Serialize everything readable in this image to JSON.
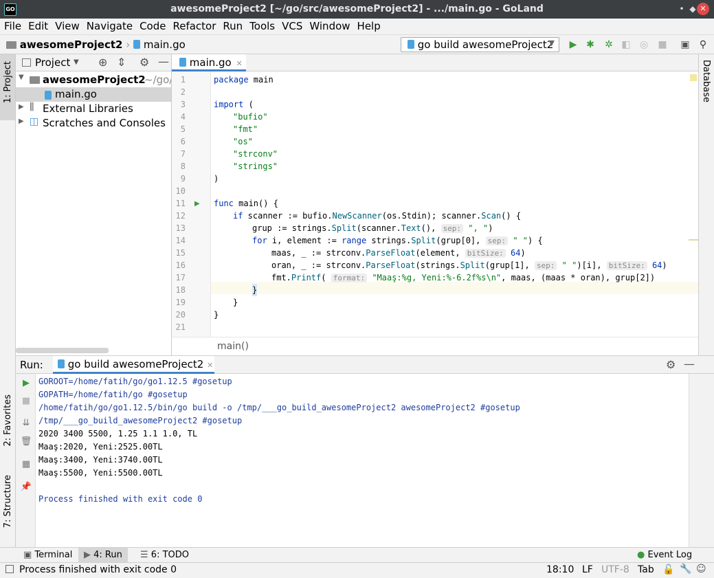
{
  "window": {
    "title": "awesomeProject2 [~/go/src/awesomeProject2] - .../main.go - GoLand",
    "app_icon": "GO",
    "minimize": "•",
    "maximize": "◆",
    "close": "✕"
  },
  "menu": [
    "File",
    "Edit",
    "View",
    "Navigate",
    "Code",
    "Refactor",
    "Run",
    "Tools",
    "VCS",
    "Window",
    "Help"
  ],
  "navbar": {
    "project": "awesomeProject2",
    "file": "main.go",
    "run_config": "go build awesomeProject2"
  },
  "left_strip": {
    "project_tab": "1: Project",
    "favorites_tab": "2: Favorites",
    "structure_tab": "7: Structure"
  },
  "right_strip": {
    "database_tab": "Database"
  },
  "project_panel": {
    "title": "Project",
    "tree": [
      {
        "label": "awesomeProject2",
        "path": "~/go/"
      },
      {
        "label": "main.go"
      },
      {
        "label": "External Libraries"
      },
      {
        "label": "Scratches and Consoles"
      }
    ]
  },
  "editor": {
    "tab": "main.go",
    "lines": [
      "1",
      "2",
      "3",
      "4",
      "5",
      "6",
      "7",
      "8",
      "9",
      "10",
      "11",
      "12",
      "13",
      "14",
      "15",
      "16",
      "17",
      "18",
      "19",
      "20",
      "21"
    ],
    "code": {
      "l1_kw": "package",
      "l1_rest": " main",
      "l3_kw": "import",
      "l3_rest": " (",
      "l4": "\"bufio\"",
      "l5": "\"fmt\"",
      "l6": "\"os\"",
      "l7": "\"strconv\"",
      "l8": "\"strings\"",
      "l9": ")",
      "l11_kw": "func",
      "l11_rest": " main() {",
      "l12_kw": "if",
      "l12_a": " scanner := bufio.",
      "l12_fn1": "NewScanner",
      "l12_b": "(os.Stdin); scanner.",
      "l12_fn2": "Scan",
      "l12_c": "() {",
      "l13_a": "grup := strings.",
      "l13_fn": "Split",
      "l13_b": "(scanner.",
      "l13_fn2": "Text",
      "l13_c": "(), ",
      "l13_hint": "sep:",
      "l13_str": "\", \"",
      "l13_d": ")",
      "l14_kw": "for",
      "l14_a": " i, element := ",
      "l14_kw2": "range",
      "l14_b": " strings.",
      "l14_fn": "Split",
      "l14_c": "(grup[0], ",
      "l14_hint": "sep:",
      "l14_str": "\" \"",
      "l14_d": ") {",
      "l15_a": "maas, _ := strconv.",
      "l15_fn": "ParseFloat",
      "l15_b": "(element, ",
      "l15_hint": "bitSize:",
      "l15_num": "64",
      "l15_c": ")",
      "l16_a": "oran, _ := strconv.",
      "l16_fn": "ParseFloat",
      "l16_b": "(strings.",
      "l16_fn2": "Split",
      "l16_c": "(grup[1], ",
      "l16_hint": "sep:",
      "l16_str": "\" \"",
      "l16_d": ")[i], ",
      "l16_hint2": "bitSize:",
      "l16_num": "64",
      "l16_e": ")",
      "l17_a": "fmt.",
      "l17_fn": "Printf",
      "l17_b": "( ",
      "l17_hint": "format:",
      "l17_str": "\"Maaş:%g, Yeni:%-6.2f%s\\n\"",
      "l17_c": ", maas, (maas * oran), grup[2])",
      "l18": "}",
      "l19": "}",
      "l20": "}"
    },
    "breadcrumb": "main()"
  },
  "run_panel": {
    "label": "Run:",
    "tab": "go build awesomeProject2",
    "console": [
      "GOROOT=/home/fatih/go/go1.12.5 #gosetup",
      "GOPATH=/home/fatih/go #gosetup",
      "/home/fatih/go/go1.12.5/bin/go build -o /tmp/___go_build_awesomeProject2 awesomeProject2 #gosetup",
      "/tmp/___go_build_awesomeProject2 #gosetup",
      "2020 3400 5500, 1.25 1.1 1.0, TL",
      "Maaş:2020, Yeni:2525.00TL",
      "Maaş:3400, Yeni:3740.00TL",
      "Maaş:5500, Yeni:5500.00TL",
      "",
      "Process finished with exit code 0"
    ]
  },
  "bottom_tabs": {
    "terminal": "Terminal",
    "run": "4: Run",
    "todo": "6: TODO",
    "event_log": "Event Log"
  },
  "status": {
    "message": "Process finished with exit code 0",
    "position": "18:10",
    "line_sep": "LF",
    "encoding": "UTF-8",
    "indent": "Tab"
  },
  "colors": {
    "accent": "#4083c9",
    "run_green": "#3c9a3c",
    "console_blue": "#1f3e9c",
    "keyword": "#0033b3",
    "string": "#067d17"
  }
}
